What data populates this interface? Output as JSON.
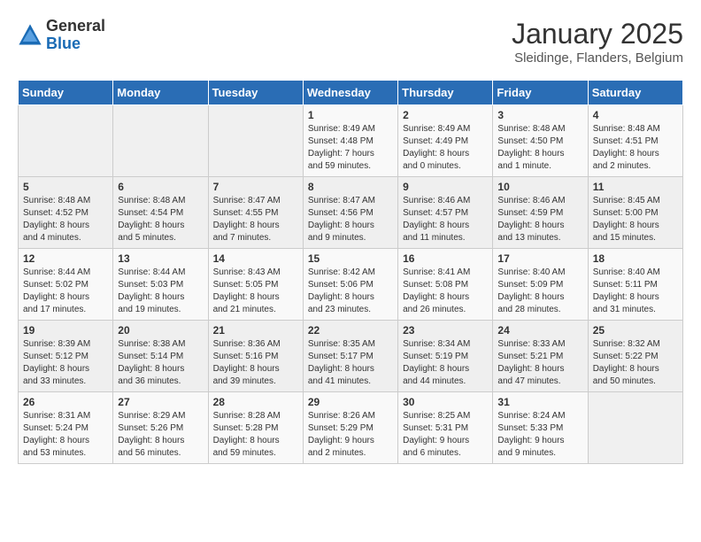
{
  "logo": {
    "general": "General",
    "blue": "Blue"
  },
  "title": "January 2025",
  "subtitle": "Sleidinge, Flanders, Belgium",
  "headers": [
    "Sunday",
    "Monday",
    "Tuesday",
    "Wednesday",
    "Thursday",
    "Friday",
    "Saturday"
  ],
  "weeks": [
    [
      {
        "day": "",
        "info": ""
      },
      {
        "day": "",
        "info": ""
      },
      {
        "day": "",
        "info": ""
      },
      {
        "day": "1",
        "info": "Sunrise: 8:49 AM\nSunset: 4:48 PM\nDaylight: 7 hours\nand 59 minutes."
      },
      {
        "day": "2",
        "info": "Sunrise: 8:49 AM\nSunset: 4:49 PM\nDaylight: 8 hours\nand 0 minutes."
      },
      {
        "day": "3",
        "info": "Sunrise: 8:48 AM\nSunset: 4:50 PM\nDaylight: 8 hours\nand 1 minute."
      },
      {
        "day": "4",
        "info": "Sunrise: 8:48 AM\nSunset: 4:51 PM\nDaylight: 8 hours\nand 2 minutes."
      }
    ],
    [
      {
        "day": "5",
        "info": "Sunrise: 8:48 AM\nSunset: 4:52 PM\nDaylight: 8 hours\nand 4 minutes."
      },
      {
        "day": "6",
        "info": "Sunrise: 8:48 AM\nSunset: 4:54 PM\nDaylight: 8 hours\nand 5 minutes."
      },
      {
        "day": "7",
        "info": "Sunrise: 8:47 AM\nSunset: 4:55 PM\nDaylight: 8 hours\nand 7 minutes."
      },
      {
        "day": "8",
        "info": "Sunrise: 8:47 AM\nSunset: 4:56 PM\nDaylight: 8 hours\nand 9 minutes."
      },
      {
        "day": "9",
        "info": "Sunrise: 8:46 AM\nSunset: 4:57 PM\nDaylight: 8 hours\nand 11 minutes."
      },
      {
        "day": "10",
        "info": "Sunrise: 8:46 AM\nSunset: 4:59 PM\nDaylight: 8 hours\nand 13 minutes."
      },
      {
        "day": "11",
        "info": "Sunrise: 8:45 AM\nSunset: 5:00 PM\nDaylight: 8 hours\nand 15 minutes."
      }
    ],
    [
      {
        "day": "12",
        "info": "Sunrise: 8:44 AM\nSunset: 5:02 PM\nDaylight: 8 hours\nand 17 minutes."
      },
      {
        "day": "13",
        "info": "Sunrise: 8:44 AM\nSunset: 5:03 PM\nDaylight: 8 hours\nand 19 minutes."
      },
      {
        "day": "14",
        "info": "Sunrise: 8:43 AM\nSunset: 5:05 PM\nDaylight: 8 hours\nand 21 minutes."
      },
      {
        "day": "15",
        "info": "Sunrise: 8:42 AM\nSunset: 5:06 PM\nDaylight: 8 hours\nand 23 minutes."
      },
      {
        "day": "16",
        "info": "Sunrise: 8:41 AM\nSunset: 5:08 PM\nDaylight: 8 hours\nand 26 minutes."
      },
      {
        "day": "17",
        "info": "Sunrise: 8:40 AM\nSunset: 5:09 PM\nDaylight: 8 hours\nand 28 minutes."
      },
      {
        "day": "18",
        "info": "Sunrise: 8:40 AM\nSunset: 5:11 PM\nDaylight: 8 hours\nand 31 minutes."
      }
    ],
    [
      {
        "day": "19",
        "info": "Sunrise: 8:39 AM\nSunset: 5:12 PM\nDaylight: 8 hours\nand 33 minutes."
      },
      {
        "day": "20",
        "info": "Sunrise: 8:38 AM\nSunset: 5:14 PM\nDaylight: 8 hours\nand 36 minutes."
      },
      {
        "day": "21",
        "info": "Sunrise: 8:36 AM\nSunset: 5:16 PM\nDaylight: 8 hours\nand 39 minutes."
      },
      {
        "day": "22",
        "info": "Sunrise: 8:35 AM\nSunset: 5:17 PM\nDaylight: 8 hours\nand 41 minutes."
      },
      {
        "day": "23",
        "info": "Sunrise: 8:34 AM\nSunset: 5:19 PM\nDaylight: 8 hours\nand 44 minutes."
      },
      {
        "day": "24",
        "info": "Sunrise: 8:33 AM\nSunset: 5:21 PM\nDaylight: 8 hours\nand 47 minutes."
      },
      {
        "day": "25",
        "info": "Sunrise: 8:32 AM\nSunset: 5:22 PM\nDaylight: 8 hours\nand 50 minutes."
      }
    ],
    [
      {
        "day": "26",
        "info": "Sunrise: 8:31 AM\nSunset: 5:24 PM\nDaylight: 8 hours\nand 53 minutes."
      },
      {
        "day": "27",
        "info": "Sunrise: 8:29 AM\nSunset: 5:26 PM\nDaylight: 8 hours\nand 56 minutes."
      },
      {
        "day": "28",
        "info": "Sunrise: 8:28 AM\nSunset: 5:28 PM\nDaylight: 8 hours\nand 59 minutes."
      },
      {
        "day": "29",
        "info": "Sunrise: 8:26 AM\nSunset: 5:29 PM\nDaylight: 9 hours\nand 2 minutes."
      },
      {
        "day": "30",
        "info": "Sunrise: 8:25 AM\nSunset: 5:31 PM\nDaylight: 9 hours\nand 6 minutes."
      },
      {
        "day": "31",
        "info": "Sunrise: 8:24 AM\nSunset: 5:33 PM\nDaylight: 9 hours\nand 9 minutes."
      },
      {
        "day": "",
        "info": ""
      }
    ]
  ]
}
